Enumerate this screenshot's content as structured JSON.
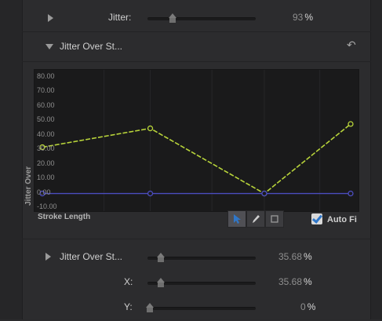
{
  "rows": {
    "jitter": {
      "label": "Jitter:",
      "value": "93",
      "unit": "%",
      "slider_fraction": 0.29
    },
    "jitter_over_stroke_header": {
      "label": "Jitter Over St..."
    },
    "jitter_over_stroke_param": {
      "label": "Jitter Over St...",
      "value": "35.68",
      "unit": "%"
    },
    "x": {
      "label": "X:",
      "value": "35.68",
      "unit": "%"
    },
    "y": {
      "label": "Y:",
      "value": "0",
      "unit": "%"
    }
  },
  "graph": {
    "ylabel": "Jitter Over",
    "xlabel": "Stroke Length",
    "auto_fit_label": "Auto Fi",
    "icons": {
      "reset": "reset-arrow-icon",
      "select": "arrow-pointer-icon",
      "pen": "pen-icon",
      "box": "box-icon"
    },
    "colors": {
      "curve": "#b8d43a",
      "baseline": "#4b4dbf",
      "selected_tool": "#2f77c9"
    }
  },
  "chart_data": {
    "type": "line",
    "title": "",
    "xlabel": "Stroke Length",
    "ylabel": "Jitter Over",
    "y_ticks": [
      "80.00",
      "70.00",
      "60.00",
      "50.00",
      "40.00",
      "30.00",
      "20.00",
      "10.00",
      "0.00",
      "-10.00"
    ],
    "ylim": [
      -10,
      80
    ],
    "xlim": [
      0,
      1
    ],
    "grid": true,
    "series": [
      {
        "x": [
          0,
          0.35,
          0.72,
          1.0
        ],
        "values": [
          32,
          45,
          0,
          48
        ]
      },
      {
        "x": [
          0,
          0.35,
          0.72,
          1.0
        ],
        "values": [
          0,
          0,
          0,
          0
        ]
      }
    ]
  }
}
